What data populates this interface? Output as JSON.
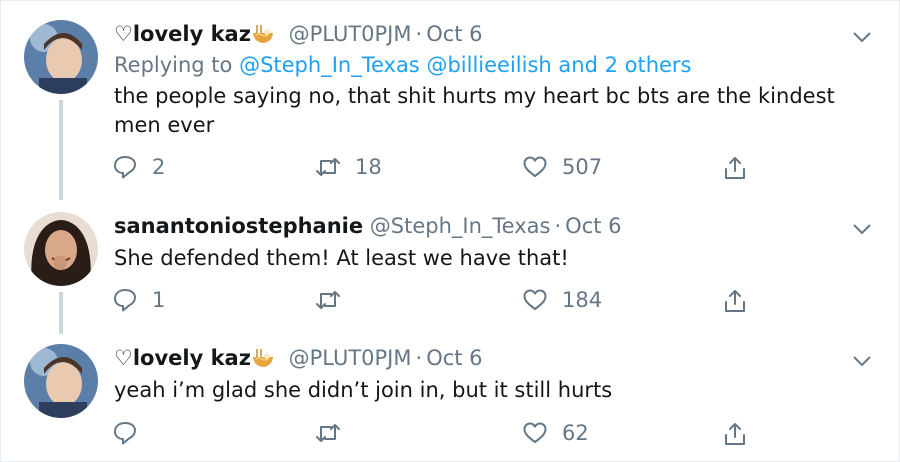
{
  "tweets": [
    {
      "name": "♡lovely kaz",
      "handle": "@PLUT0PJM",
      "dot": "·",
      "time": "Oct 6",
      "replying_prefix": "Replying to ",
      "replying_users": [
        "@Steph_In_Texas",
        "@billieeilish"
      ],
      "replying_and": " and ",
      "replying_others": "2 others",
      "text": "the people saying no, that shit hurts my heart bc bts are the kindest men ever",
      "replies": "2",
      "retweets": "18",
      "likes": "507"
    },
    {
      "name": "sanantoniostephanie",
      "handle": "@Steph_In_Texas",
      "dot": "·",
      "time": "Oct 6",
      "text": "She defended them! At least we have that!",
      "replies": "1",
      "retweets": "",
      "likes": "184"
    },
    {
      "name": "♡lovely kaz",
      "handle": "@PLUT0PJM",
      "dot": "·",
      "time": "Oct 6",
      "text": "yeah i’m glad she didn’t join in, but it still hurts",
      "replies": "",
      "retweets": "",
      "likes": "62"
    }
  ],
  "colors": {
    "link": "#1da1f2",
    "muted": "#657786",
    "thread": "#ccd6dd",
    "text": "#14171a"
  }
}
